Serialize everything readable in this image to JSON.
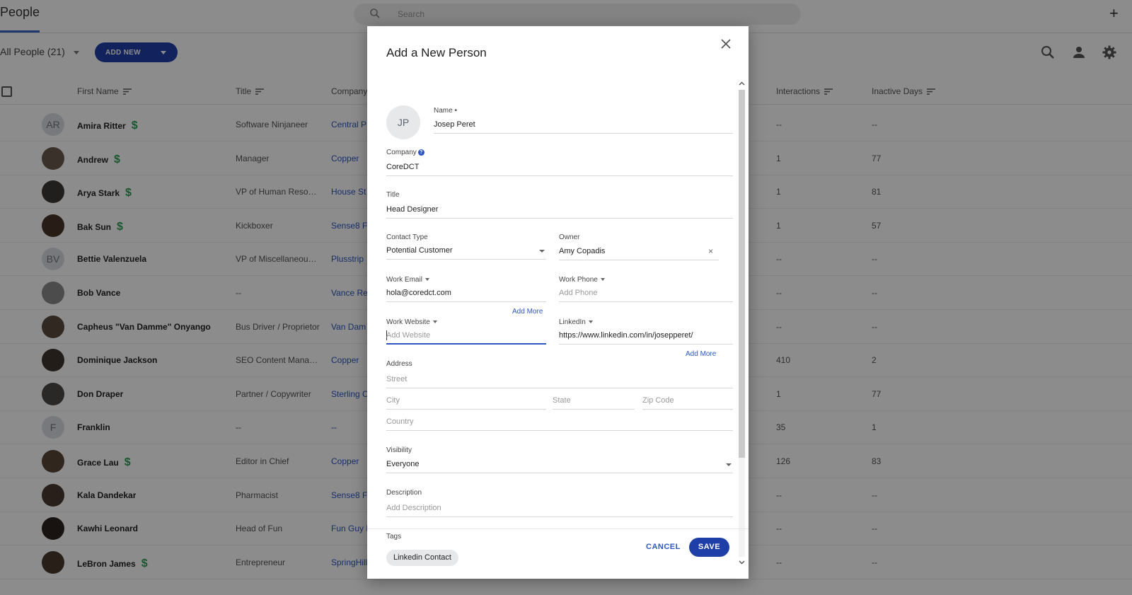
{
  "app": {
    "title": "People",
    "search_placeholder": "Search",
    "view_label": "All People (21)",
    "add_new_label": "ADD NEW",
    "columns": {
      "first_name": "First Name",
      "title": "Title",
      "company": "Company",
      "interactions": "Interactions",
      "inactive_days": "Inactive Days"
    },
    "rows": [
      {
        "initials": "AR",
        "name": "Amira Ritter",
        "dollar": "$",
        "title": "Software Ninjaneer",
        "company": "Central P",
        "interactions": "--",
        "inactive": "--"
      },
      {
        "initials": "",
        "name": "Andrew",
        "dollar": "$",
        "title": "Manager",
        "company": "Copper",
        "interactions": "1",
        "inactive": "77"
      },
      {
        "initials": "",
        "name": "Arya Stark",
        "dollar": "$",
        "title": "VP of Human Resour...",
        "company": "House St",
        "interactions": "1",
        "inactive": "81"
      },
      {
        "initials": "",
        "name": "Bak Sun",
        "dollar": "$",
        "title": "Kickboxer",
        "company": "Sense8 F",
        "interactions": "1",
        "inactive": "57"
      },
      {
        "initials": "BV",
        "name": "Bettie Valenzuela",
        "dollar": "",
        "title": "VP of Miscellaneous ...",
        "company": "Plusstrip",
        "interactions": "--",
        "inactive": "--"
      },
      {
        "initials": "",
        "name": "Bob Vance",
        "dollar": "",
        "title": "--",
        "company": "Vance Ref",
        "interactions": "--",
        "inactive": "--"
      },
      {
        "initials": "",
        "name": "Capheus \"Van Damme\" Onyango",
        "dollar": "",
        "title": "Bus Driver / Proprietor",
        "company": "Van Dam",
        "interactions": "--",
        "inactive": "--"
      },
      {
        "initials": "",
        "name": "Dominique Jackson",
        "dollar": "",
        "title": "SEO Content Manager",
        "company": "Copper",
        "interactions": "410",
        "inactive": "2"
      },
      {
        "initials": "",
        "name": "Don Draper",
        "dollar": "",
        "title": "Partner / Copywriter",
        "company": "Sterling C",
        "interactions": "1",
        "inactive": "77"
      },
      {
        "initials": "F",
        "name": "Franklin",
        "dollar": "",
        "title": "--",
        "company": "--",
        "interactions": "35",
        "inactive": "1"
      },
      {
        "initials": "",
        "name": "Grace Lau",
        "dollar": "$",
        "title": "Editor in Chief",
        "company": "Copper",
        "interactions": "126",
        "inactive": "83"
      },
      {
        "initials": "",
        "name": "Kala Dandekar",
        "dollar": "",
        "title": "Pharmacist",
        "company": "Sense8 F",
        "interactions": "--",
        "inactive": "--"
      },
      {
        "initials": "",
        "name": "Kawhi Leonard",
        "dollar": "",
        "title": "Head of Fun",
        "company": "Fun Guy B",
        "interactions": "--",
        "inactive": "--"
      },
      {
        "initials": "",
        "name": "LeBron James",
        "dollar": "$",
        "title": "Entrepreneur",
        "company": "SpringHill",
        "interactions": "--",
        "inactive": "--"
      }
    ]
  },
  "dialog": {
    "title": "Add a New Person",
    "avatar_initials": "JP",
    "name_label": "Name",
    "required_marker": "•",
    "name_value": "Josep Peret",
    "company_label": "Company",
    "help_glyph": "?",
    "company_value": "CoreDCT",
    "title_label": "Title",
    "title_value": "Head Designer",
    "contact_type_label": "Contact Type",
    "contact_type_value": "Potential Customer",
    "owner_label": "Owner",
    "owner_value": "Amy Copadis",
    "clear_glyph": "×",
    "work_email_label": "Work Email",
    "work_email_value": "hola@coredct.com",
    "work_phone_label": "Work Phone",
    "work_phone_placeholder": "Add Phone",
    "add_more_label": "Add More",
    "work_website_label": "Work Website",
    "work_website_placeholder": "Add Website",
    "linkedin_label": "LinkedIn",
    "linkedin_value": "https://www.linkedin.com/in/josepperet/",
    "address_label": "Address",
    "street_placeholder": "Street",
    "city_placeholder": "City",
    "state_placeholder": "State",
    "zip_placeholder": "Zip Code",
    "country_placeholder": "Country",
    "visibility_label": "Visibility",
    "visibility_value": "Everyone",
    "description_label": "Description",
    "description_placeholder": "Add Description",
    "tags_label": "Tags",
    "tag_value": "Linkedin Contact",
    "cancel_label": "CANCEL",
    "save_label": "SAVE"
  },
  "colors": {
    "accent": "#1f3fa8",
    "link": "#2d56c0",
    "money": "#2f9e57"
  },
  "icons": [
    "search-icon",
    "plus-icon",
    "user-icon",
    "gear-icon",
    "sort-icon",
    "close-icon",
    "chevron-down-icon",
    "help-icon"
  ]
}
